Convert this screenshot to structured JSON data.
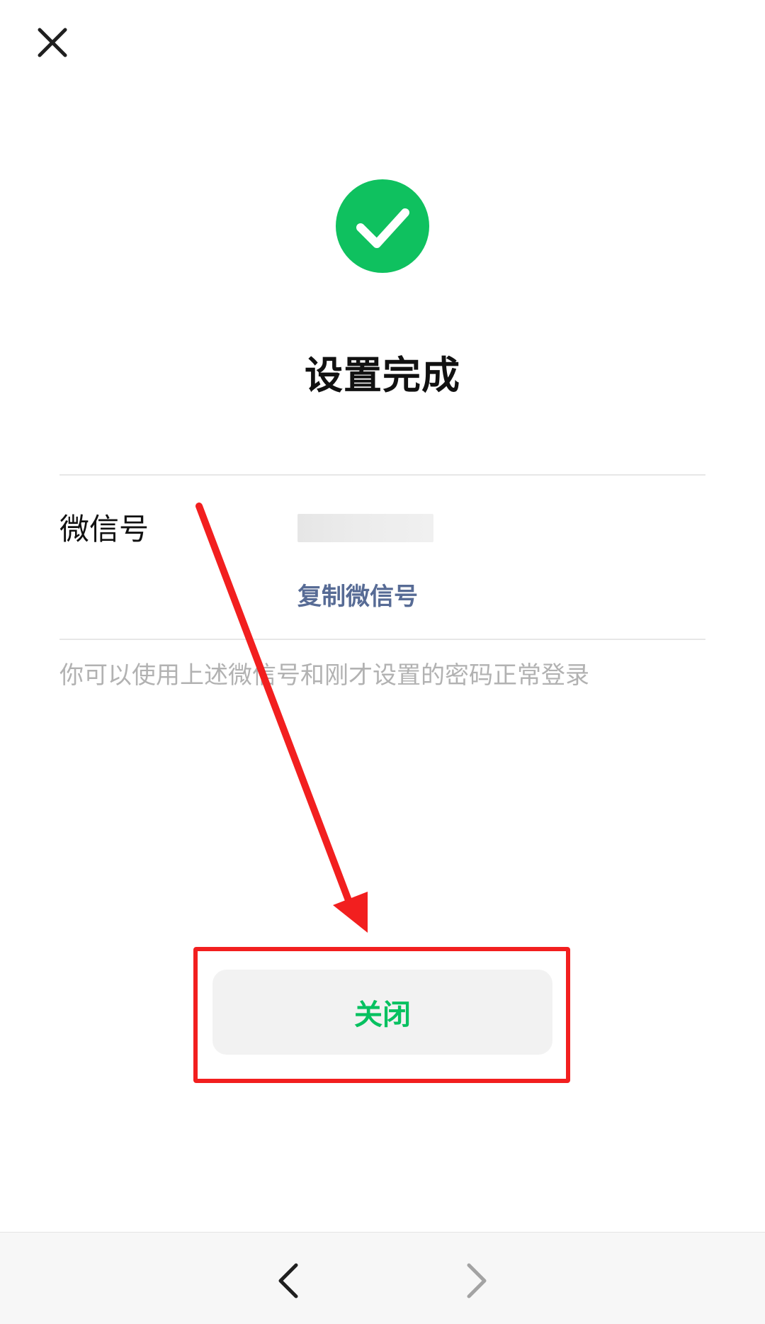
{
  "header": {
    "close_icon": "close-icon"
  },
  "status": {
    "icon": "check-circle-icon",
    "title": "设置完成",
    "accent_color": "#0fc15f"
  },
  "account": {
    "label": "微信号",
    "value": "",
    "copy_label": "复制微信号"
  },
  "hint": "你可以使用上述微信号和刚才设置的密码正常登录",
  "primary_button": {
    "label": "关闭",
    "color": "#07c160"
  },
  "annotation": {
    "color": "#f21f1f",
    "shapes": [
      "arrow",
      "rectangle"
    ]
  },
  "bottom_nav": {
    "back_icon": "chevron-left-icon",
    "forward_icon": "chevron-right-icon"
  }
}
